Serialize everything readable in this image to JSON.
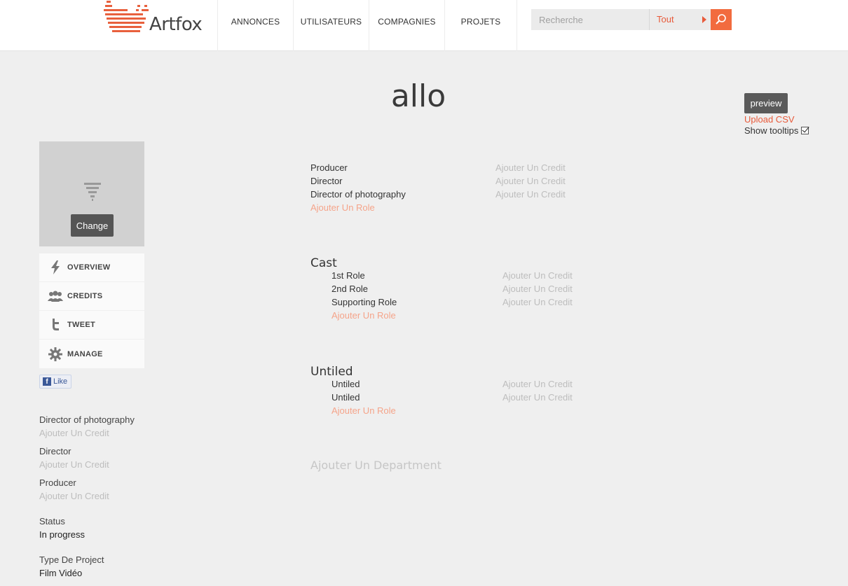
{
  "header": {
    "logo_text": "Artfox",
    "nav": [
      "ANNONCES",
      "UTILISATEURS",
      "COMPAGNIES",
      "PROJETS"
    ],
    "search": {
      "placeholder": "Recherche",
      "scope": "Tout",
      "button_icon": "search-icon"
    }
  },
  "colors": {
    "accent": "#f26b3e",
    "link": "#e85a3a",
    "faded_link": "#f5a48a",
    "background": "#efefef"
  },
  "project": {
    "title": "allo"
  },
  "actions": {
    "preview": "preview",
    "upload_csv": "Upload CSV",
    "show_tooltips": "Show tooltips",
    "show_tooltips_checked": true
  },
  "sidebar": {
    "change_label": "Change",
    "menu": [
      {
        "label": "OVERVIEW",
        "icon": "lightning-icon"
      },
      {
        "label": "CREDITS",
        "icon": "people-icon"
      },
      {
        "label": "TWEET",
        "icon": "twitter-icon"
      },
      {
        "label": "MANAGE",
        "icon": "gear-icon"
      }
    ],
    "like_label": "Like",
    "info": [
      {
        "key": "Director of photography",
        "value": "Ajouter Un Credit"
      },
      {
        "key": "Director",
        "value": "Ajouter Un Credit"
      },
      {
        "key": "Producer",
        "value": "Ajouter Un Credit"
      },
      {
        "key": "Status",
        "value": "In progress"
      },
      {
        "key": "Type De Project",
        "value": "Film Vidéo"
      }
    ]
  },
  "credits": {
    "add_credit": "Ajouter Un Credit",
    "add_role": "Ajouter Un Role",
    "add_department": "Ajouter Un Department",
    "crew_roles": [
      "Producer",
      "Director",
      "Director of photography"
    ],
    "departments": [
      {
        "name": "Cast",
        "roles": [
          "1st Role",
          "2nd Role",
          "Supporting Role"
        ]
      },
      {
        "name": "Untiled",
        "roles": [
          "Untiled",
          "Untiled"
        ]
      }
    ]
  }
}
